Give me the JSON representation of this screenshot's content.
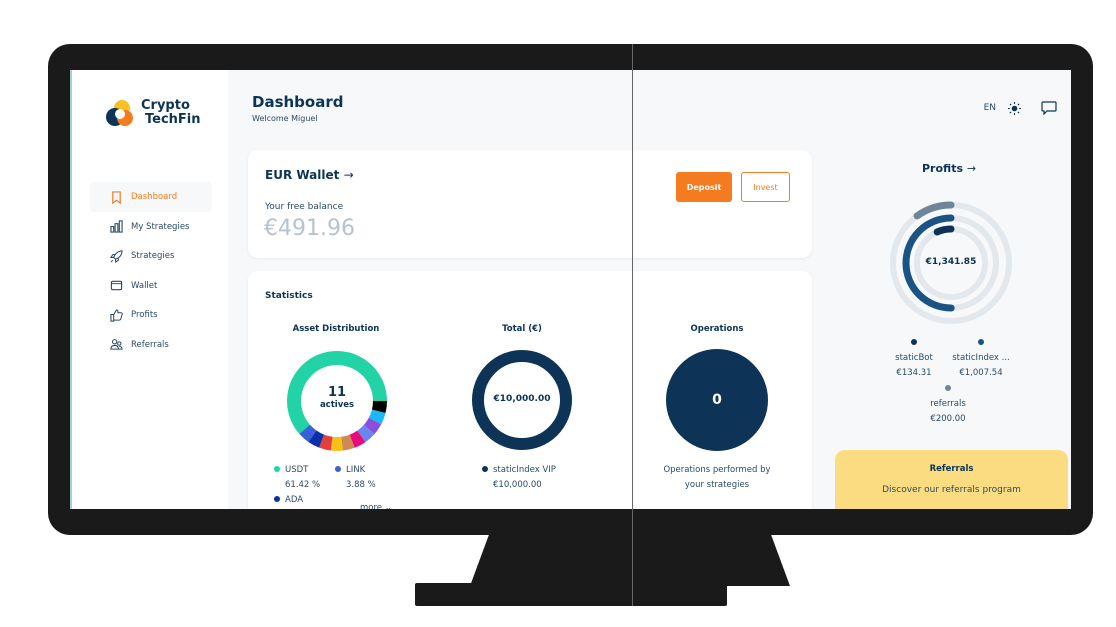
{
  "brand": {
    "line1": "Crypto",
    "line2": "TechFin"
  },
  "sidebar": {
    "items": [
      {
        "label": "Dashboard",
        "icon": "bookmark-icon",
        "active": true
      },
      {
        "label": "My Strategies",
        "icon": "bar-chart-icon"
      },
      {
        "label": "Strategies",
        "icon": "rocket-icon"
      },
      {
        "label": "Wallet",
        "icon": "wallet-icon"
      },
      {
        "label": "Profits",
        "icon": "thumbs-up-icon"
      },
      {
        "label": "Referrals",
        "icon": "users-icon"
      }
    ]
  },
  "header": {
    "title": "Dashboard",
    "welcome": "Welcome Miguel",
    "lang": "EN"
  },
  "wallet": {
    "title": "EUR Wallet",
    "free_label": "Your free balance",
    "balance": "€491.96",
    "deposit": "Deposit",
    "invest": "Invest"
  },
  "stats": {
    "title": "Statistics",
    "asset": {
      "title": "Asset Distribution",
      "count": "11",
      "count_label": "actives",
      "legend": [
        {
          "name": "USDT",
          "value": "61.42 %",
          "color": "#22d3a5"
        },
        {
          "name": "LINK",
          "value": "3.88 %",
          "color": "#3a5fd9"
        },
        {
          "name": "ADA",
          "color": "#0a2fa8"
        }
      ],
      "more": "more"
    },
    "total": {
      "title": "Total (€)",
      "value": "€10,000.00",
      "legend": {
        "name": "staticIndex VIP",
        "value": "€10,000.00"
      }
    },
    "operations": {
      "title": "Operations",
      "value": "0",
      "desc1": "Operations performed by",
      "desc2": "your strategies"
    }
  },
  "profits": {
    "title": "Profits",
    "total": "€1,341.85",
    "items": [
      {
        "name": "staticBot",
        "value": "€134.31",
        "color": "#0d3456"
      },
      {
        "name": "staticIndex ...",
        "value": "€1,007.54",
        "color": "#1b5385"
      },
      {
        "name": "referrals",
        "value": "€200.00",
        "color": "#6f8599"
      }
    ]
  },
  "referrals": {
    "title": "Referrals",
    "desc": "Discover our referrals program"
  },
  "chart_data": [
    {
      "type": "pie",
      "title": "Asset Distribution",
      "slices": [
        {
          "name": "USDT",
          "value": 61.42,
          "color": "#22d3a5"
        },
        {
          "name": "LINK",
          "value": 3.88,
          "color": "#3a5fd9"
        },
        {
          "name": "ADA",
          "color": "#0a2fa8"
        }
      ]
    },
    {
      "type": "pie",
      "title": "Total (€)",
      "slices": [
        {
          "name": "staticIndex VIP",
          "value": 10000
        }
      ]
    },
    {
      "type": "pie",
      "title": "Profits",
      "slices": [
        {
          "name": "staticBot",
          "value": 134.31
        },
        {
          "name": "staticIndex ...",
          "value": 1007.54
        },
        {
          "name": "referrals",
          "value": 200.0
        }
      ]
    }
  ]
}
